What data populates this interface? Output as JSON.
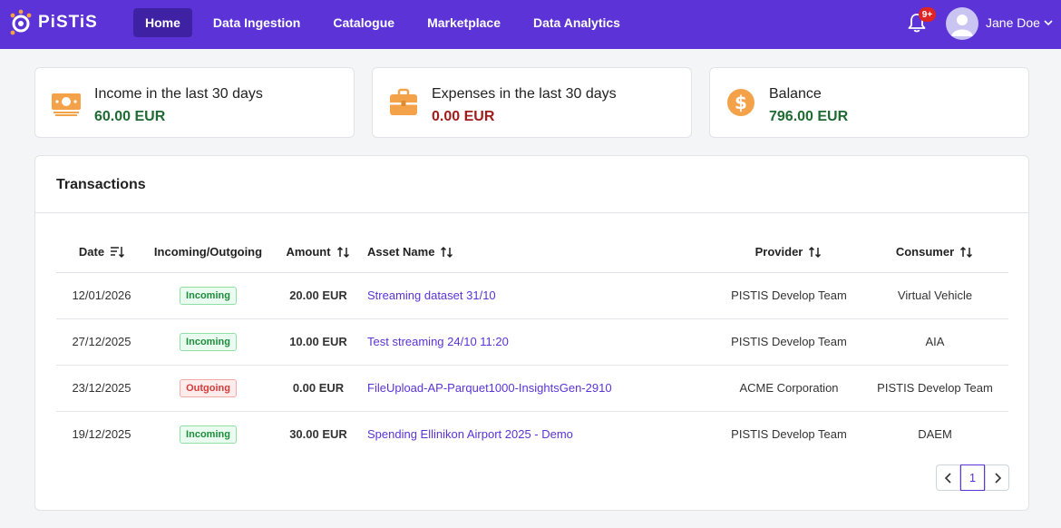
{
  "brand": {
    "logo_text": "PiSTiS",
    "accent": "#5b33d6"
  },
  "nav": {
    "items": [
      {
        "label": "Home",
        "active": true
      },
      {
        "label": "Data Ingestion"
      },
      {
        "label": "Catalogue"
      },
      {
        "label": "Marketplace"
      },
      {
        "label": "Data Analytics"
      }
    ],
    "notifications_badge": "9+",
    "user_name": "Jane Doe"
  },
  "summary": {
    "income": {
      "label": "Income in the last 30 days",
      "value": "60.00 EUR",
      "icon": "money-icon"
    },
    "expenses": {
      "label": "Expenses in the last 30 days",
      "value": "0.00 EUR",
      "icon": "briefcase-icon"
    },
    "balance": {
      "label": "Balance",
      "value": "796.00 EUR",
      "icon": "dollar-coin-icon"
    }
  },
  "transactions": {
    "title": "Transactions",
    "columns": [
      "Date",
      "Incoming/Outgoing",
      "Amount",
      "Asset Name",
      "Provider",
      "Consumer"
    ],
    "rows": [
      {
        "date": "12/01/2026",
        "direction": "Incoming",
        "amount": "20.00 EUR",
        "asset": "Streaming dataset 31/10",
        "provider": "PISTIS Develop Team",
        "consumer": "Virtual Vehicle"
      },
      {
        "date": "27/12/2025",
        "direction": "Incoming",
        "amount": "10.00 EUR",
        "asset": "Test streaming 24/10 11:20",
        "provider": "PISTIS Develop Team",
        "consumer": "AIA"
      },
      {
        "date": "23/12/2025",
        "direction": "Outgoing",
        "amount": "0.00 EUR",
        "asset": "FileUpload-AP-Parquet1000-InsightsGen-2910",
        "provider": "ACME Corporation",
        "consumer": "PISTIS Develop Team"
      },
      {
        "date": "19/12/2025",
        "direction": "Incoming",
        "amount": "30.00 EUR",
        "asset": "Spending Ellinikon Airport 2025 - Demo",
        "provider": "PISTIS Develop Team",
        "consumer": "DAEM"
      }
    ],
    "pagination": {
      "current_page": "1"
    }
  }
}
